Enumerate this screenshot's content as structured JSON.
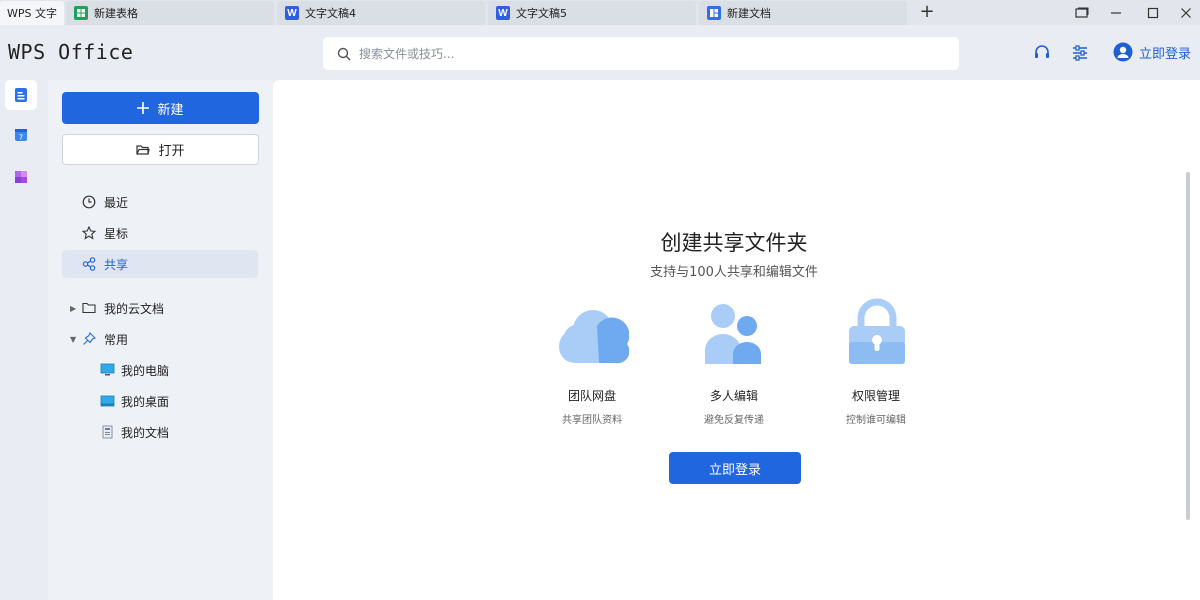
{
  "tabs": [
    {
      "label": "WPS 文字",
      "icon": "wps-home"
    },
    {
      "label": "新建表格",
      "icon": "spreadsheet-icon"
    },
    {
      "label": "文字文稿4",
      "icon": "word-icon"
    },
    {
      "label": "文字文稿5",
      "icon": "word-icon"
    },
    {
      "label": "新建文档",
      "icon": "doc-icon"
    }
  ],
  "header": {
    "logo": "WPS Office",
    "search_placeholder": "搜索文件或技巧...",
    "login_label": "立即登录"
  },
  "sidebar": {
    "new_label": "新建",
    "open_label": "打开",
    "nav": [
      {
        "label": "最近",
        "icon": "clock-icon"
      },
      {
        "label": "星标",
        "icon": "star-icon"
      },
      {
        "label": "共享",
        "icon": "share-icon"
      }
    ],
    "tree": [
      {
        "label": "我的云文档",
        "icon": "folder-icon"
      },
      {
        "label": "常用",
        "icon": "pin-icon"
      },
      {
        "label": "我的电脑",
        "icon": "computer-icon"
      },
      {
        "label": "我的桌面",
        "icon": "desktop-icon"
      },
      {
        "label": "我的文档",
        "icon": "document-icon"
      }
    ]
  },
  "main": {
    "title": "创建共享文件夹",
    "subtitle": "支持与100人共享和编辑文件",
    "features": [
      {
        "name": "团队网盘",
        "desc": "共享团队资料",
        "icon": "cloud-icon"
      },
      {
        "name": "多人编辑",
        "desc": "避免反复传递",
        "icon": "users-icon"
      },
      {
        "name": "权限管理",
        "desc": "控制谁可编辑",
        "icon": "lock-icon"
      }
    ],
    "login_button": "立即登录"
  },
  "colors": {
    "accent": "#1f66df",
    "icon_light": "#a9cdf7",
    "icon_mid": "#6fa9ef"
  }
}
